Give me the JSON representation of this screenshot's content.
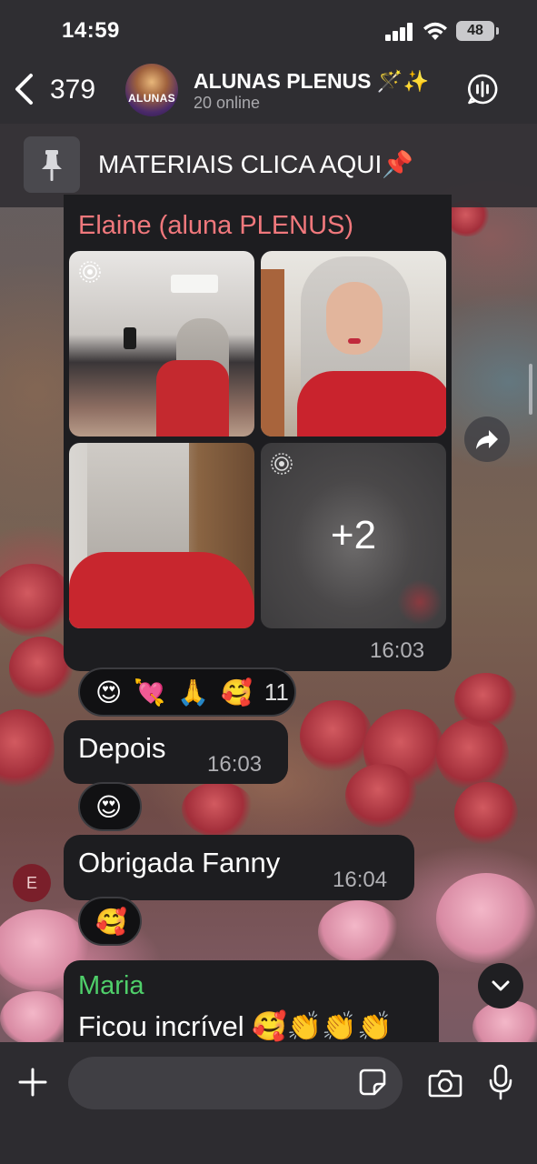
{
  "status_bar": {
    "time": "14:59",
    "battery": "48",
    "icons": [
      "signal-icon",
      "wifi-icon",
      "battery-icon"
    ]
  },
  "header": {
    "back_count": "379",
    "avatar_label": "ALUNAS",
    "title": "ALUNAS PLENUS 🪄✨",
    "subtitle": "20 online",
    "icons": [
      "back-chevron-icon",
      "voice-chat-icon"
    ]
  },
  "pinned": {
    "text": "MATERIAIS CLICA AQUI📌",
    "icon": "pin-icon"
  },
  "messages": [
    {
      "sender": "Elaine (aluna PLENUS)",
      "sender_color": "#f0787c",
      "media_more": "+2",
      "time": "16:03",
      "reactions": {
        "emojis": [
          "😍",
          "💘",
          "🙏",
          "🥰"
        ],
        "count": "11"
      }
    },
    {
      "text": "Depois",
      "time": "16:03",
      "reactions": {
        "emojis": [
          "😍"
        ]
      }
    },
    {
      "text": "Obrigada Fanny",
      "time": "16:04",
      "avatar_initial": "E",
      "reactions": {
        "emojis": [
          "🥰"
        ]
      }
    },
    {
      "sender": "Maria",
      "sender_color": "#4fcf6a",
      "text": "Ficou incrível 🥰👏👏👏"
    }
  ],
  "input": {
    "placeholder": "",
    "icons": [
      "plus-icon",
      "sticker-icon",
      "camera-icon",
      "mic-icon"
    ]
  },
  "colors": {
    "bubble": "#1d1d20",
    "header": "#2f2e32",
    "elaine_name": "#f0787c",
    "maria_name": "#4fcf6a"
  }
}
